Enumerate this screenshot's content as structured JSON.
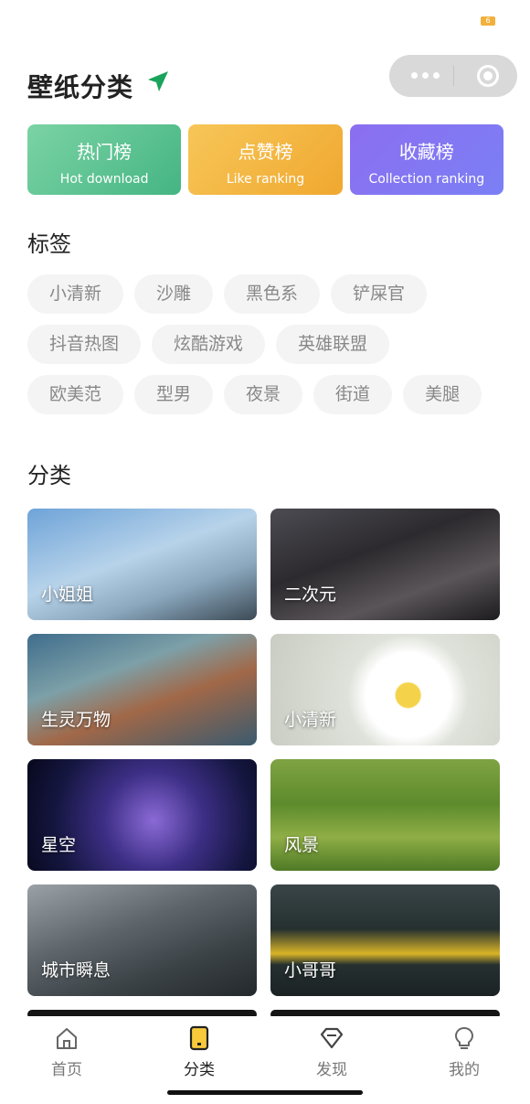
{
  "status": {
    "battery": "6"
  },
  "header": {
    "title": "壁纸分类"
  },
  "rankings": [
    {
      "cn": "热门榜",
      "en": "Hot download"
    },
    {
      "cn": "点赞榜",
      "en": "Like ranking"
    },
    {
      "cn": "收藏榜",
      "en": "Collection ranking"
    }
  ],
  "tags": {
    "title": "标签",
    "rows": [
      [
        "小清新",
        "沙雕",
        "黑色系",
        "铲屎官"
      ],
      [
        "抖音热图",
        "炫酷游戏",
        "英雄联盟"
      ],
      [
        "欧美范",
        "型男",
        "夜景",
        "街道",
        "美腿"
      ]
    ]
  },
  "categories": {
    "title": "分类",
    "items": [
      "小姐姐",
      "二次元",
      "生灵万物",
      "小清新",
      "星空",
      "风景",
      "城市瞬息",
      "小哥哥"
    ]
  },
  "nav": {
    "items": [
      {
        "label": "首页",
        "icon": "home-icon"
      },
      {
        "label": "分类",
        "icon": "category-icon"
      },
      {
        "label": "发现",
        "icon": "diamond-icon"
      },
      {
        "label": "我的",
        "icon": "bulb-icon"
      }
    ],
    "active_index": 1
  },
  "colors": {
    "accent": "#f7c93b",
    "send_icon": "#1aa35b"
  }
}
